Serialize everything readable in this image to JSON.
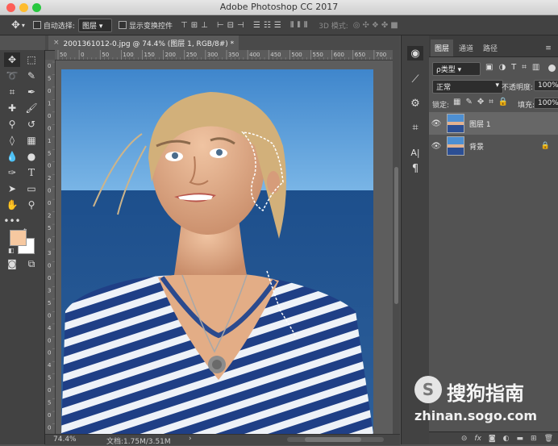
{
  "window": {
    "title": "Adobe Photoshop CC 2017"
  },
  "options_bar": {
    "auto_select_label": "自动选择:",
    "auto_select_value": "图层",
    "show_transform_label": "显示变换控件",
    "mode_3d_label": "3D 模式:"
  },
  "document": {
    "tab_label": "2001361012-0.jpg @ 74.4% (图层 1, RGB/8#) *",
    "ruler_ticks": [
      "50",
      "0",
      "50",
      "100",
      "150",
      "200",
      "250",
      "300",
      "350",
      "400",
      "450",
      "500",
      "550",
      "600",
      "650",
      "700"
    ],
    "ruler_v_ticks": [
      "0",
      "5",
      "0",
      "1",
      "0",
      "0",
      "1",
      "5",
      "0",
      "2",
      "0",
      "0",
      "2",
      "5",
      "0",
      "3",
      "0",
      "0",
      "3",
      "5",
      "0",
      "4",
      "0",
      "0",
      "4",
      "5",
      "0",
      "5",
      "0",
      "0"
    ]
  },
  "status_bar": {
    "zoom": "74.4%",
    "doc_info": "文档:1.75M/3.51M",
    "arrow": "›"
  },
  "layers_panel": {
    "tabs": [
      "图层",
      "通道",
      "路径"
    ],
    "filter_label": "ρ类型",
    "blend_mode": "正常",
    "opacity_label": "不透明度:",
    "opacity_value": "100%",
    "lock_label": "锁定:",
    "fill_label": "填充:",
    "fill_value": "100%",
    "layers": [
      {
        "name": "图层 1",
        "selected": true
      },
      {
        "name": "背景",
        "locked": true
      }
    ],
    "footer_fx": "fx"
  },
  "colors": {
    "foreground": "#f6c8a0",
    "background": "#ffffff",
    "accent_selected": "#676767"
  },
  "watermark": {
    "logo_text": "搜狗指南",
    "url": "zhinan.sogo.com"
  }
}
